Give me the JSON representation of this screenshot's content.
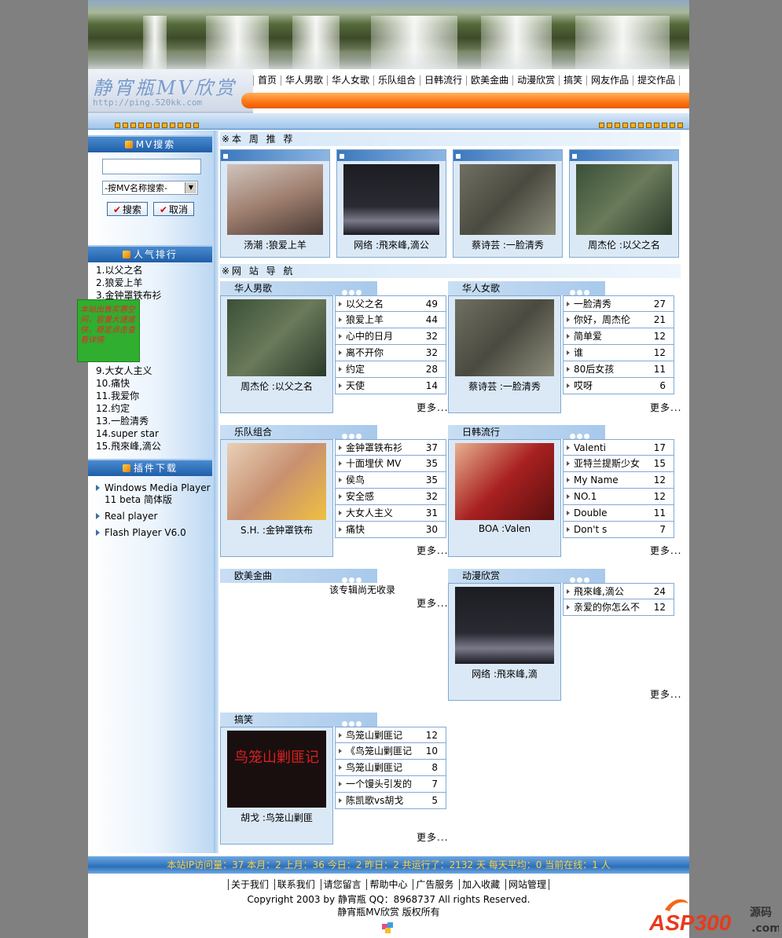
{
  "site": {
    "logo_title": "静宵瓶MV欣赏",
    "logo_url": "http://ping.520kk.com"
  },
  "nav": [
    "首页",
    "华人男歌",
    "华人女歌",
    "乐队组合",
    "日韩流行",
    "欧美金曲",
    "动漫欣赏",
    "搞笑",
    "网友作品",
    "提交作品"
  ],
  "sidebar": {
    "search_title": "MV搜索",
    "search_placeholder": "",
    "search_select": "-按MV名称搜索-",
    "search_btn": "搜索",
    "cancel_btn": "取消",
    "rank_title": "人气排行",
    "rank": [
      "1.以父之名",
      "2.狼爱上羊",
      "3.金钟罩铁布衫",
      "4.",
      "5.",
      "6.",
      "7.",
      "8.",
      "9.大女人主义",
      "10.痛快",
      "11.我爱你",
      "12.约定",
      "13.一脸清秀",
      "14.super star",
      "15.飛來峰,滴公"
    ],
    "ad_text": "本站出售实惠空间，容量大速度快，稳定点击查看详情",
    "plugin_title": "插件下载",
    "plugins": [
      "Windows Media Player 11 beta 简体版",
      "Real player",
      "Flash Player V6.0"
    ]
  },
  "weekly": {
    "title": "※本 周 推 荐",
    "items": [
      {
        "caption": "汤潮 :狼爱上羊"
      },
      {
        "caption": "网络 :飛來峰,滴公"
      },
      {
        "caption": "蔡诗芸 :一脸清秀"
      },
      {
        "caption": "周杰伦 :以父之名"
      }
    ]
  },
  "nav_title": "※网 站 导 航",
  "categories": [
    {
      "name": "华人男歌",
      "caption": "周杰伦 :以父之名",
      "more": "更多...",
      "rows": [
        [
          "以父之名",
          "49"
        ],
        [
          "狼爱上羊",
          "44"
        ],
        [
          "心中的日月",
          "32"
        ],
        [
          "离不开你",
          "32"
        ],
        [
          "约定",
          "28"
        ],
        [
          "天使",
          "14"
        ]
      ]
    },
    {
      "name": "华人女歌",
      "caption": "蔡诗芸 :一脸清秀",
      "more": "更多...",
      "rows": [
        [
          "一脸清秀",
          "27"
        ],
        [
          "你好，周杰伦",
          "21"
        ],
        [
          "简单爱",
          "12"
        ],
        [
          "谁",
          "12"
        ],
        [
          "80后女孩",
          "11"
        ],
        [
          "哎呀",
          "6"
        ]
      ]
    },
    {
      "name": "乐队组合",
      "caption": "S.H. :金钟罩铁布",
      "more": "更多...",
      "rows": [
        [
          "金钟罩铁布衫",
          "37"
        ],
        [
          "十面埋伏  MV",
          "35"
        ],
        [
          "侯鸟",
          "35"
        ],
        [
          "安全感",
          "32"
        ],
        [
          "大女人主义",
          "31"
        ],
        [
          "痛快",
          "30"
        ]
      ]
    },
    {
      "name": "日韩流行",
      "caption": "BOA :Valen",
      "more": "更多...",
      "rows": [
        [
          "Valenti",
          "17"
        ],
        [
          "亚特兰提斯少女",
          "15"
        ],
        [
          "My Name",
          "12"
        ],
        [
          "NO.1",
          "12"
        ],
        [
          "Double",
          "11"
        ],
        [
          "Don't s",
          "7"
        ]
      ]
    },
    {
      "name": "欧美金曲",
      "empty": "该专辑尚无收录",
      "more": "更多..."
    },
    {
      "name": "动漫欣赏",
      "caption": "网络 :飛來峰,滴",
      "more": "更多...",
      "rows": [
        [
          "飛來峰,滴公",
          "24"
        ],
        [
          "亲爱的你怎么不",
          "12"
        ]
      ]
    },
    {
      "name": "搞笑",
      "caption": "胡戈 :鸟笼山剿匪",
      "more": "更多...",
      "img_text": "鸟笼山剿匪记",
      "rows": [
        [
          "鸟笼山剿匪记",
          "12"
        ],
        [
          "《鸟笼山剿匪记",
          "10"
        ],
        [
          "鸟笼山剿匪记",
          "8"
        ],
        [
          "一个馒头引发的",
          "7"
        ],
        [
          "陈凯歌vs胡戈",
          "5"
        ]
      ]
    }
  ],
  "footer": {
    "stats": "本站IP访问量：37 本月：2 上月：36 今日：2 昨日：2 共运行了：2132 天  每天平均：0 当前在线：1 人",
    "links": [
      "关于我们",
      "联系我们",
      "请您留言",
      "帮助中心",
      "广告服务",
      "加入收藏",
      "网站管理"
    ],
    "copyright": "Copyright 2003 by 静宵瓶  QQ：8968737 All rights Reserved.",
    "rights": "静宵瓶MV欣赏  版权所有",
    "watermark": "ASP300",
    "watermark_sub1": "源码",
    "watermark_sub2": ".com"
  },
  "colors": {
    "accent": "#2b6fba",
    "orange": "#ff7a18",
    "panel": "#dbe9f6",
    "border": "#7fa9d4",
    "page_bg": "#7f807f"
  }
}
